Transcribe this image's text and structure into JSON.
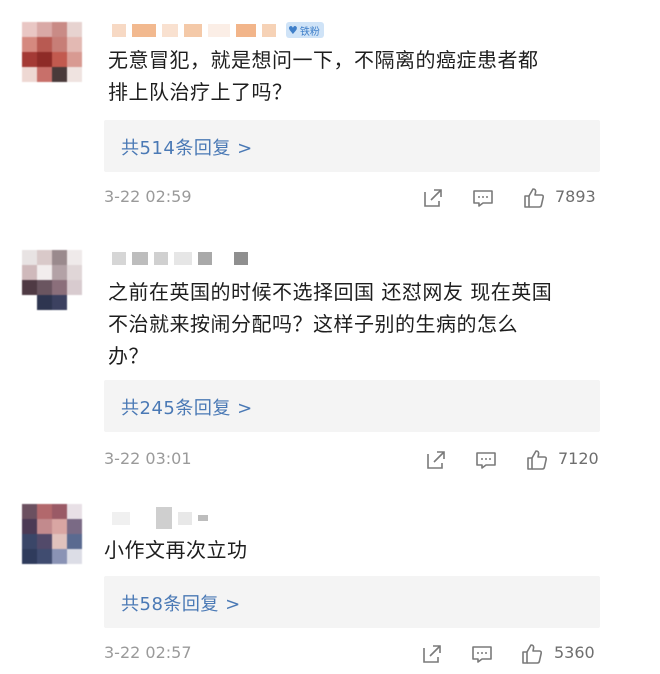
{
  "comments": [
    {
      "badge": "铁粉",
      "text_line1": "无意冒犯，就是想问一下，不隔离的癌症患者都",
      "text_line2": "排上队治疗上了吗？",
      "reply_label": "共514条回复 >",
      "time": "3-22 02:59",
      "likes": "7893"
    },
    {
      "text_line1": "之前在英国的时候不选择回国 还怼网友 现在英国",
      "text_line2": "不治就来按闹分配吗？这样子别的生病的怎么",
      "text_line3": "办？",
      "reply_label": "共245条回复 >",
      "time": "3-22 03:01",
      "likes": "7120"
    },
    {
      "text_line1": "小作文再次立功",
      "reply_label": "共58条回复 >",
      "time": "3-22 02:57",
      "likes": "5360"
    }
  ],
  "icons": {
    "share": "share-icon",
    "comment": "comment-icon",
    "like": "thumbs-up-icon"
  },
  "colors": {
    "reply_link": "#4a79b5",
    "reply_bg": "#f4f4f4",
    "meta_text": "#9a9a9a",
    "badge_bg": "#cfe3f7"
  }
}
